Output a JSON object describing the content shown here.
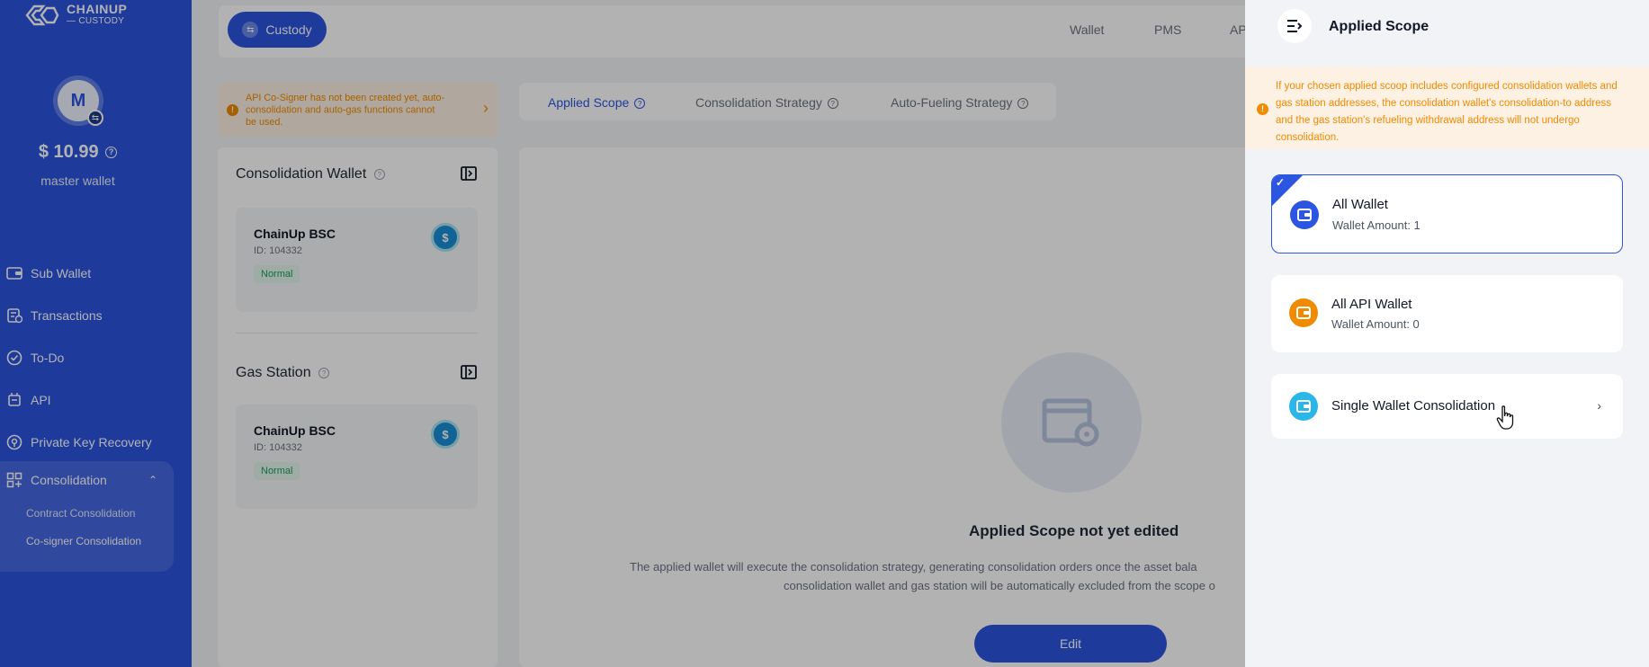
{
  "brand": {
    "name": "CHAINUP",
    "sub": "— CUSTODY",
    "primary": "#2c55e0",
    "warning": "#f08a00",
    "success": "#18a058"
  },
  "profile": {
    "initial": "M",
    "balance": "$ 10.99",
    "balance_help_icon": "question-circle-icon",
    "wallet_label": "master wallet"
  },
  "sidebar": {
    "items": [
      {
        "label": "Sub Wallet",
        "icon": "wallet-icon"
      },
      {
        "label": "Transactions",
        "icon": "transactions-icon"
      },
      {
        "label": "To-Do",
        "icon": "todo-icon"
      },
      {
        "label": "API",
        "icon": "api-icon"
      },
      {
        "label": "Private Key Recovery",
        "icon": "key-recovery-icon"
      }
    ],
    "group": {
      "label": "Consolidation",
      "icon": "consolidation-icon",
      "expanded": true,
      "children": [
        {
          "label": "Contract Consolidation",
          "active": false
        },
        {
          "label": "Co-signer Consolidation",
          "active": true
        }
      ]
    }
  },
  "topbar": {
    "custody_label": "Custody",
    "nav": [
      "Wallet",
      "PMS",
      "AP"
    ]
  },
  "left_warning": {
    "lines": [
      "API Co-Signer has not been created yet, auto-",
      "consolidation and auto-gas functions cannot",
      "be used."
    ]
  },
  "left_panel": {
    "consolidation_wallet": {
      "title": "Consolidation Wallet",
      "card": {
        "name": "ChainUp BSC",
        "id": "ID: 104332",
        "status": "Normal"
      }
    },
    "gas_station": {
      "title": "Gas Station",
      "card": {
        "name": "ChainUp BSC",
        "id": "ID: 104332",
        "status": "Normal"
      }
    }
  },
  "tabs": [
    {
      "label": "Applied Scope",
      "active": true
    },
    {
      "label": "Consolidation Strategy",
      "active": false
    },
    {
      "label": "Auto-Fueling Strategy",
      "active": false
    }
  ],
  "empty_state": {
    "icon": "settings-window-icon",
    "title": "Applied Scope not yet edited",
    "desc_line1": "The applied wallet will execute the consolidation strategy, generating consolidation orders once the asset bala",
    "desc_line2": "consolidation wallet and gas station will be automatically excluded from the scope o",
    "edit_label": "Edit"
  },
  "drawer": {
    "title": "Applied Scope",
    "warning_lines": [
      "If your chosen applied scoop includes configured consolidation wallets and",
      "gas station addresses, the consolidation wallet's consolidation-to address",
      "and the gas station's refueling withdrawal address will not undergo",
      "consolidation."
    ],
    "options": [
      {
        "title": "All Wallet",
        "sub": "Wallet Amount: 1",
        "selected": true,
        "icon_color": "#2c55e0"
      },
      {
        "title": "All API Wallet",
        "sub": "Wallet Amount: 0",
        "selected": false,
        "icon_color": "#f08a00"
      },
      {
        "title": "Single Wallet Consolidation",
        "selected": false,
        "icon_color": "#29b6e8"
      }
    ]
  }
}
